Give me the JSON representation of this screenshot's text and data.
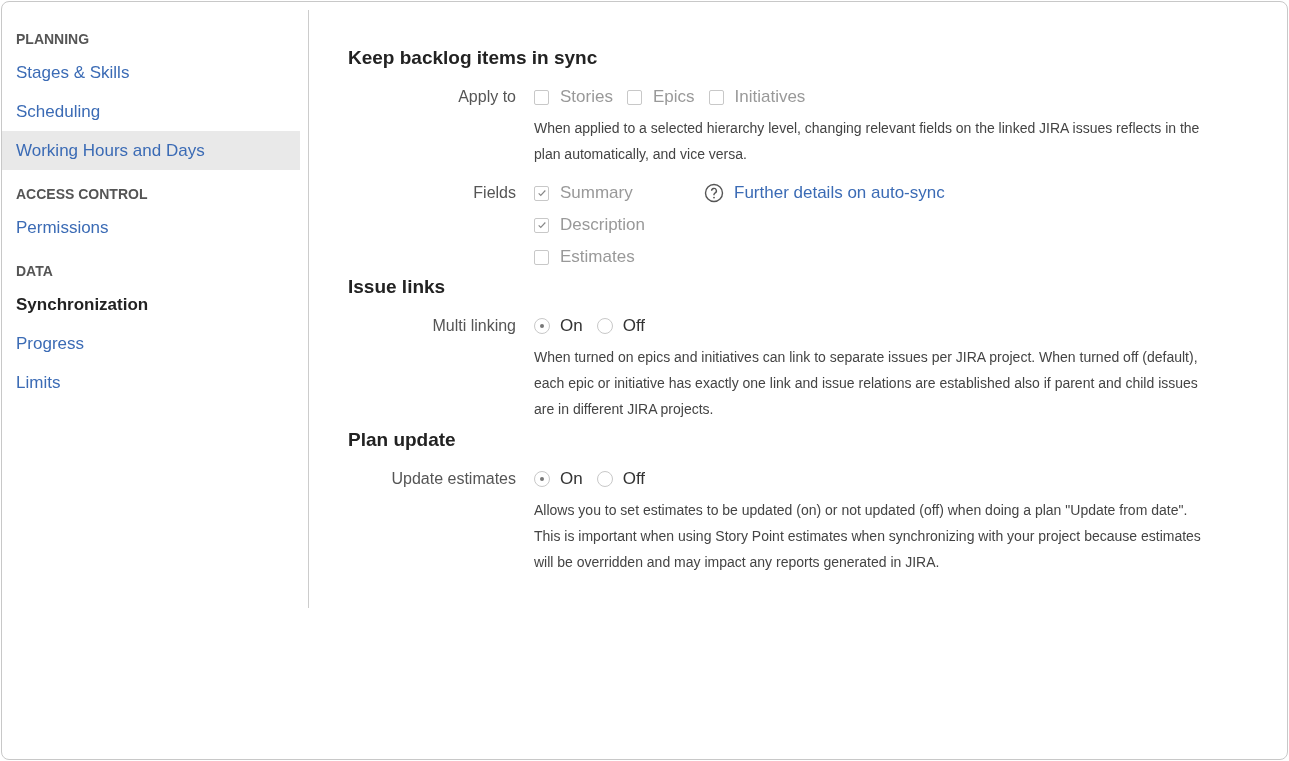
{
  "sidebar": {
    "groups": [
      {
        "heading": "PLANNING",
        "items": [
          {
            "label": "Stages & Skills",
            "selected": false,
            "hovered": false
          },
          {
            "label": "Scheduling",
            "selected": false,
            "hovered": false
          },
          {
            "label": "Working Hours and Days",
            "selected": false,
            "hovered": true
          }
        ]
      },
      {
        "heading": "ACCESS CONTROL",
        "items": [
          {
            "label": "Permissions",
            "selected": false,
            "hovered": false
          }
        ]
      },
      {
        "heading": "DATA",
        "items": [
          {
            "label": "Synchronization",
            "selected": true,
            "hovered": false
          },
          {
            "label": "Progress",
            "selected": false,
            "hovered": false
          },
          {
            "label": "Limits",
            "selected": false,
            "hovered": false
          }
        ]
      }
    ]
  },
  "sections": [
    {
      "title": "Keep backlog items in sync",
      "rows": [
        {
          "label": "Apply to",
          "kind": "checkbox_inline",
          "options": [
            {
              "label": "Stories",
              "checked": false,
              "disabled": true
            },
            {
              "label": "Epics",
              "checked": false,
              "disabled": true
            },
            {
              "label": "Initiatives",
              "checked": false,
              "disabled": true
            }
          ],
          "description": "When applied to a selected hierarchy level, changing relevant fields on the linked JIRA issues reflects in the plan automatically, and vice versa."
        },
        {
          "label": "Fields",
          "kind": "checkbox_stack",
          "options": [
            {
              "label": "Summary",
              "checked": true,
              "disabled": true
            },
            {
              "label": "Description",
              "checked": true,
              "disabled": true
            },
            {
              "label": "Estimates",
              "checked": false,
              "disabled": true
            }
          ],
          "link": "Further details on auto-sync"
        }
      ]
    },
    {
      "title": "Issue links",
      "rows": [
        {
          "label": "Multi linking",
          "kind": "radio",
          "options": [
            {
              "label": "On",
              "selected": true
            },
            {
              "label": "Off",
              "selected": false
            }
          ],
          "description": "When turned on epics and initiatives can link to separate issues per JIRA project. When turned off (default), each epic or initiative has exactly one link and issue relations are established also if parent and child issues are in different JIRA projects."
        }
      ]
    },
    {
      "title": "Plan update",
      "rows": [
        {
          "label": "Update estimates",
          "kind": "radio",
          "options": [
            {
              "label": "On",
              "selected": true
            },
            {
              "label": "Off",
              "selected": false
            }
          ],
          "description": "Allows you to set estimates to be updated (on) or not updated (off) when doing a plan \"Update from date\". This is important when using Story Point estimates when synchronizing with your project because estimates will be overridden and may impact any reports generated in JIRA."
        }
      ]
    }
  ]
}
